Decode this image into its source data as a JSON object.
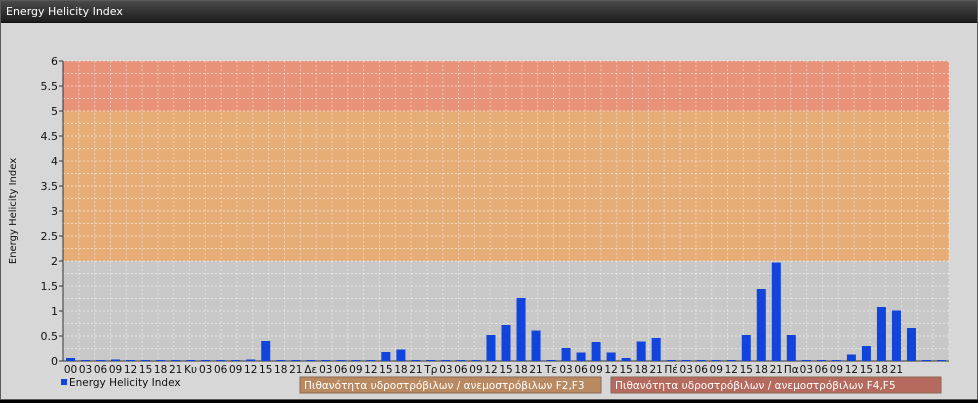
{
  "window": {
    "title": "Energy Helicity Index"
  },
  "colors": {
    "bar": "#1144dd",
    "band_f2f3": "#e9a96a",
    "band_f4f5": "#ea8a6d",
    "plot_bg": "#c8c8c8",
    "legend_f2f3": "#b98a62",
    "legend_f4f5": "#b66a5e"
  },
  "chart_data": {
    "type": "bar",
    "ylabel": "Energy Helicity Index",
    "ylim": [
      0,
      6
    ],
    "yticks": [
      "0",
      "0.5",
      "1",
      "1.5",
      "2",
      "2.5",
      "3",
      "3.5",
      "4",
      "4.5",
      "5",
      "5.5",
      "6"
    ],
    "grid": true,
    "categories": [
      "00",
      "03",
      "06",
      "09",
      "12",
      "15",
      "18",
      "21",
      "Κυ",
      "03",
      "06",
      "09",
      "12",
      "15",
      "18",
      "21",
      "Δε",
      "03",
      "06",
      "09",
      "12",
      "15",
      "18",
      "21",
      "Τρ",
      "03",
      "06",
      "09",
      "12",
      "15",
      "18",
      "21",
      "Τε",
      "03",
      "06",
      "09",
      "12",
      "15",
      "18",
      "21",
      "Πέ",
      "03",
      "06",
      "09",
      "12",
      "15",
      "18",
      "21",
      "Πα",
      "03",
      "06",
      "09",
      "12",
      "15",
      "18",
      "21"
    ],
    "series": [
      {
        "name": "Energy Helicity Index",
        "values": [
          0.06,
          0.02,
          0.02,
          0.03,
          0.02,
          0.02,
          0.02,
          0.02,
          0.02,
          0.02,
          0.02,
          0.02,
          0.03,
          0.4,
          0.02,
          0.02,
          0.02,
          0.02,
          0.02,
          0.02,
          0.02,
          0.18,
          0.23,
          0.02,
          0.02,
          0.02,
          0.02,
          0.02,
          0.52,
          0.72,
          1.26,
          0.61,
          0.02,
          0.26,
          0.17,
          0.38,
          0.17,
          0.06,
          0.39,
          0.46,
          0.02,
          0.02,
          0.02,
          0.02,
          0.02,
          0.52,
          1.44,
          1.97,
          0.52,
          0.02,
          0.02,
          0.02,
          0.13,
          0.3,
          1.08,
          1.01,
          0.66,
          0.02,
          0.02
        ]
      }
    ],
    "bands": [
      {
        "label": "Πιθανότητα υδροστρόβιλων / ανεμοστρόβιλων F2,F3",
        "from": 2,
        "to": 5
      },
      {
        "label": "Πιθανότητα υδροστρόβιλων / ανεμοστρόβιλων F4,F5",
        "from": 5,
        "to": 6
      }
    ],
    "legend": "bottom-left"
  }
}
